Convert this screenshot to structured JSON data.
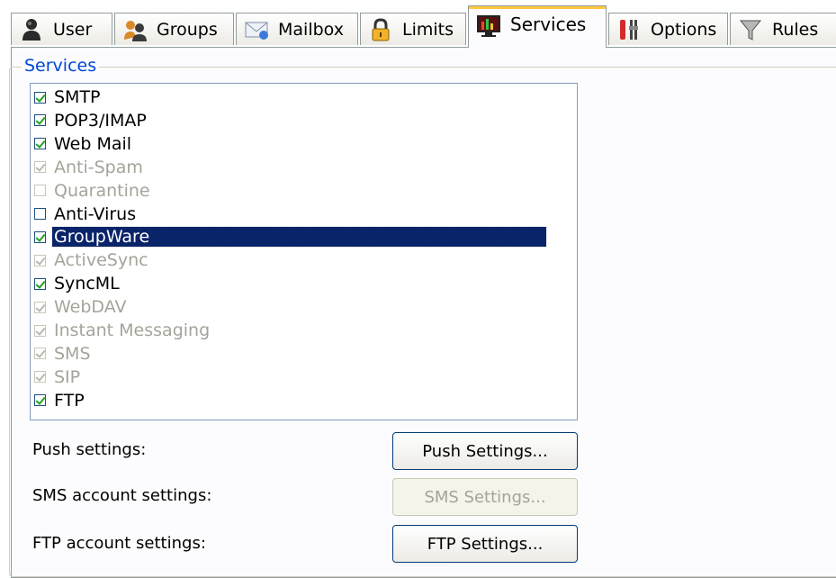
{
  "tabs": [
    {
      "label": "User",
      "icon": "user-icon",
      "active": false
    },
    {
      "label": "Groups",
      "icon": "groups-icon",
      "active": false
    },
    {
      "label": "Mailbox",
      "icon": "mailbox-icon",
      "active": false
    },
    {
      "label": "Limits",
      "icon": "lock-icon",
      "active": false
    },
    {
      "label": "Services",
      "icon": "monitor-icon",
      "active": true
    },
    {
      "label": "Options",
      "icon": "tools-icon",
      "active": false
    },
    {
      "label": "Rules",
      "icon": "filter-icon",
      "active": false
    }
  ],
  "services": {
    "group_title": "Services",
    "items": [
      {
        "label": "SMTP",
        "checked": true,
        "enabled": true,
        "selected": false
      },
      {
        "label": "POP3/IMAP",
        "checked": true,
        "enabled": true,
        "selected": false
      },
      {
        "label": "Web Mail",
        "checked": true,
        "enabled": true,
        "selected": false
      },
      {
        "label": "Anti-Spam",
        "checked": true,
        "enabled": false,
        "selected": false
      },
      {
        "label": "Quarantine",
        "checked": false,
        "enabled": false,
        "selected": false
      },
      {
        "label": "Anti-Virus",
        "checked": false,
        "enabled": true,
        "selected": false
      },
      {
        "label": "GroupWare",
        "checked": true,
        "enabled": true,
        "selected": true
      },
      {
        "label": "ActiveSync",
        "checked": true,
        "enabled": false,
        "selected": false
      },
      {
        "label": "SyncML",
        "checked": true,
        "enabled": true,
        "selected": false
      },
      {
        "label": "WebDAV",
        "checked": true,
        "enabled": false,
        "selected": false
      },
      {
        "label": "Instant Messaging",
        "checked": true,
        "enabled": false,
        "selected": false
      },
      {
        "label": "SMS",
        "checked": true,
        "enabled": false,
        "selected": false
      },
      {
        "label": "SIP",
        "checked": true,
        "enabled": false,
        "selected": false
      },
      {
        "label": "FTP",
        "checked": true,
        "enabled": true,
        "selected": false
      }
    ]
  },
  "settings": {
    "push": {
      "label": "Push settings:",
      "button": "Push Settings...",
      "enabled": true
    },
    "sms": {
      "label": "SMS account settings:",
      "button": "SMS Settings...",
      "enabled": false
    },
    "ftp": {
      "label": "FTP account settings:",
      "button": "FTP Settings...",
      "enabled": true
    }
  },
  "colors": {
    "selection": "#0a246a",
    "group_title": "#0046d5",
    "check_green": "#21a121",
    "disabled_text": "#a4a49a",
    "active_tab_accent": "#ffc83c"
  }
}
